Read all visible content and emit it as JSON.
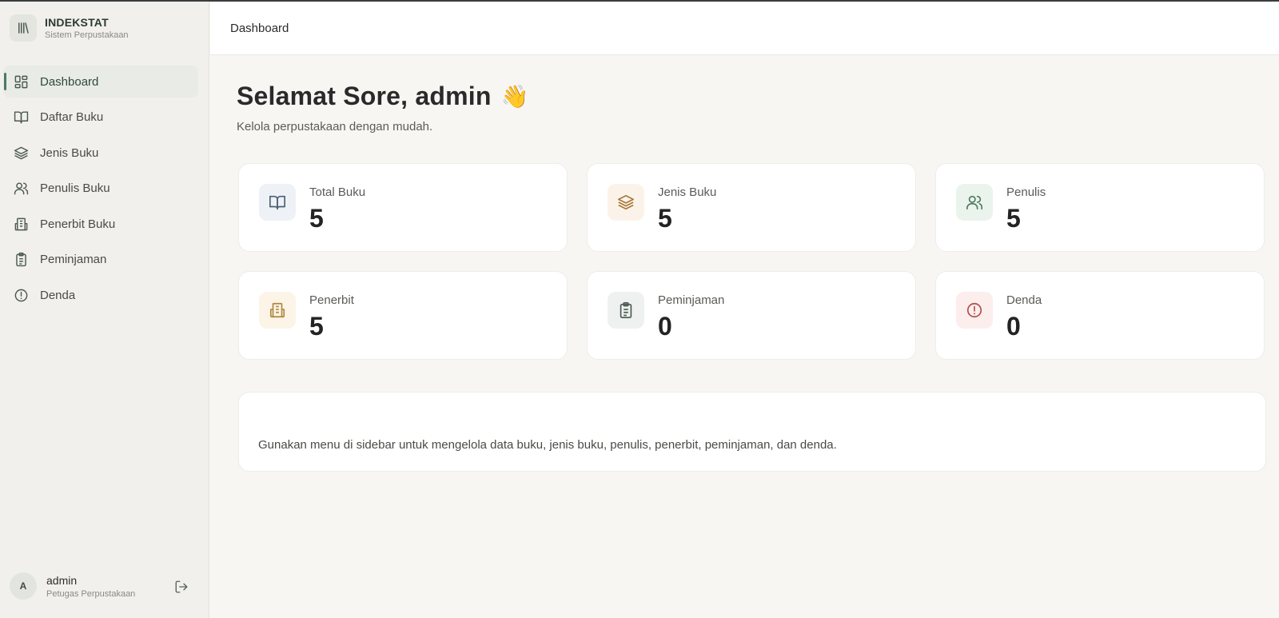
{
  "brand": {
    "title": "INDEKSTAT",
    "subtitle": "Sistem Perpustakaan"
  },
  "nav": [
    {
      "label": "Dashboard",
      "icon": "dashboard-icon",
      "active": true
    },
    {
      "label": "Daftar Buku",
      "icon": "book-open-icon"
    },
    {
      "label": "Jenis Buku",
      "icon": "layers-icon"
    },
    {
      "label": "Penulis Buku",
      "icon": "users-icon"
    },
    {
      "label": "Penerbit Buku",
      "icon": "building-icon"
    },
    {
      "label": "Peminjaman",
      "icon": "clipboard-icon"
    },
    {
      "label": "Denda",
      "icon": "alert-circle-icon"
    }
  ],
  "user": {
    "initial": "A",
    "name": "admin",
    "role": "Petugas Perpustakaan",
    "logout_icon": "logout-icon"
  },
  "header": {
    "title": "Dashboard"
  },
  "greeting": {
    "text": "Selamat Sore, admin",
    "emoji": "👋",
    "subtitle": "Kelola perpustakaan dengan mudah."
  },
  "stats": [
    {
      "label": "Total Buku",
      "value": "5",
      "icon": "book-open-icon",
      "bg": "#eef1f5",
      "color": "#4a6076"
    },
    {
      "label": "Jenis Buku",
      "value": "5",
      "icon": "layers-icon",
      "bg": "#fbf3e9",
      "color": "#a87a3a"
    },
    {
      "label": "Penulis",
      "value": "5",
      "icon": "users-icon",
      "bg": "#eaf3ec",
      "color": "#4d7a5f"
    },
    {
      "label": "Penerbit",
      "value": "5",
      "icon": "building-icon",
      "bg": "#fcf4e6",
      "color": "#b08640"
    },
    {
      "label": "Peminjaman",
      "value": "0",
      "icon": "clipboard-icon",
      "bg": "#eef1ef",
      "color": "#4b5a52"
    },
    {
      "label": "Denda",
      "value": "0",
      "icon": "alert-circle-icon",
      "bg": "#fbeeed",
      "color": "#b0504a"
    }
  ],
  "info": {
    "title": "",
    "text": "Gunakan menu di sidebar untuk mengelola data buku, jenis buku, penulis, penerbit, peminjaman, dan denda."
  },
  "colors": {
    "accent": "#4d7a5f",
    "sidebar_bg": "#f1f0ec",
    "page_bg": "#f7f6f3"
  }
}
